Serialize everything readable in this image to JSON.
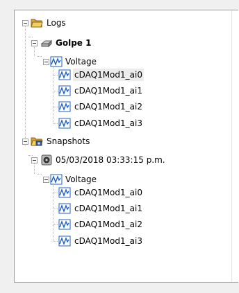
{
  "tree": {
    "logs": {
      "label": "Logs",
      "icon": "folder-open-icon",
      "children": {
        "golpe": {
          "label": "Golpe 1",
          "icon": "disk-drive-icon",
          "voltage": {
            "label": "Voltage",
            "icon": "waveform-icon",
            "channels": [
              "cDAQ1Mod1_ai0",
              "cDAQ1Mod1_ai1",
              "cDAQ1Mod1_ai2",
              "cDAQ1Mod1_ai3"
            ]
          }
        }
      }
    },
    "snapshots": {
      "label": "Snapshots",
      "icon": "folder-camera-icon",
      "children": {
        "snapshot": {
          "label": "05/03/2018 03:33:15 p.m.",
          "icon": "snapshot-disk-icon",
          "voltage": {
            "label": "Voltage",
            "icon": "waveform-icon",
            "channels": [
              "cDAQ1Mod1_ai0",
              "cDAQ1Mod1_ai1",
              "cDAQ1Mod1_ai2",
              "cDAQ1Mod1_ai3"
            ]
          }
        }
      }
    }
  },
  "colors": {
    "selection": "#ececec",
    "folder": "#e8b83d",
    "waveform": "#1e5fbf"
  }
}
